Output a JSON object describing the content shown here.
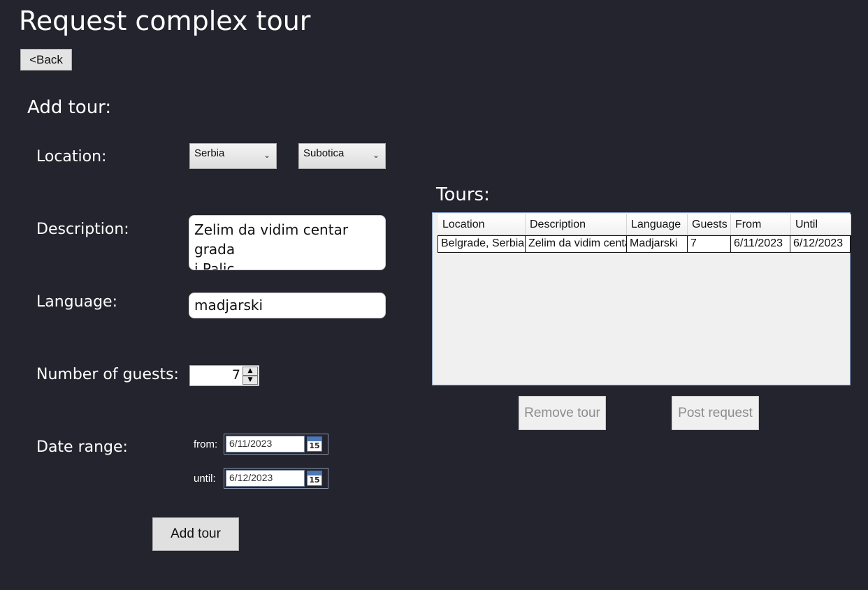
{
  "page": {
    "title": "Request complex tour",
    "back_label": "<Back"
  },
  "form": {
    "section_title": "Add tour:",
    "location_label": "Location:",
    "country_value": "Serbia",
    "city_value": "Subotica",
    "description_label": "Description:",
    "description_value": "Zelim da vidim centar grada\ni Palic",
    "language_label": "Language:",
    "language_value": "madjarski",
    "guests_label": "Number of guests:",
    "guests_value": "7",
    "date_range_label": "Date range:",
    "from_label": "from:",
    "from_value": "6/11/2023",
    "until_label": "until:",
    "until_value": "6/12/2023",
    "calendar_day": "15",
    "add_tour_label": "Add tour"
  },
  "tours": {
    "title": "Tours:",
    "columns": [
      "Location",
      "Description",
      "Language",
      "Guests",
      "From",
      "Until"
    ],
    "rows": [
      [
        "Belgrade, Serbia",
        "Zelim da vidim centar grada",
        "Madjarski",
        "7",
        "6/11/2023",
        "6/12/2023"
      ]
    ],
    "remove_label": "Remove tour",
    "post_label": "Post request"
  }
}
